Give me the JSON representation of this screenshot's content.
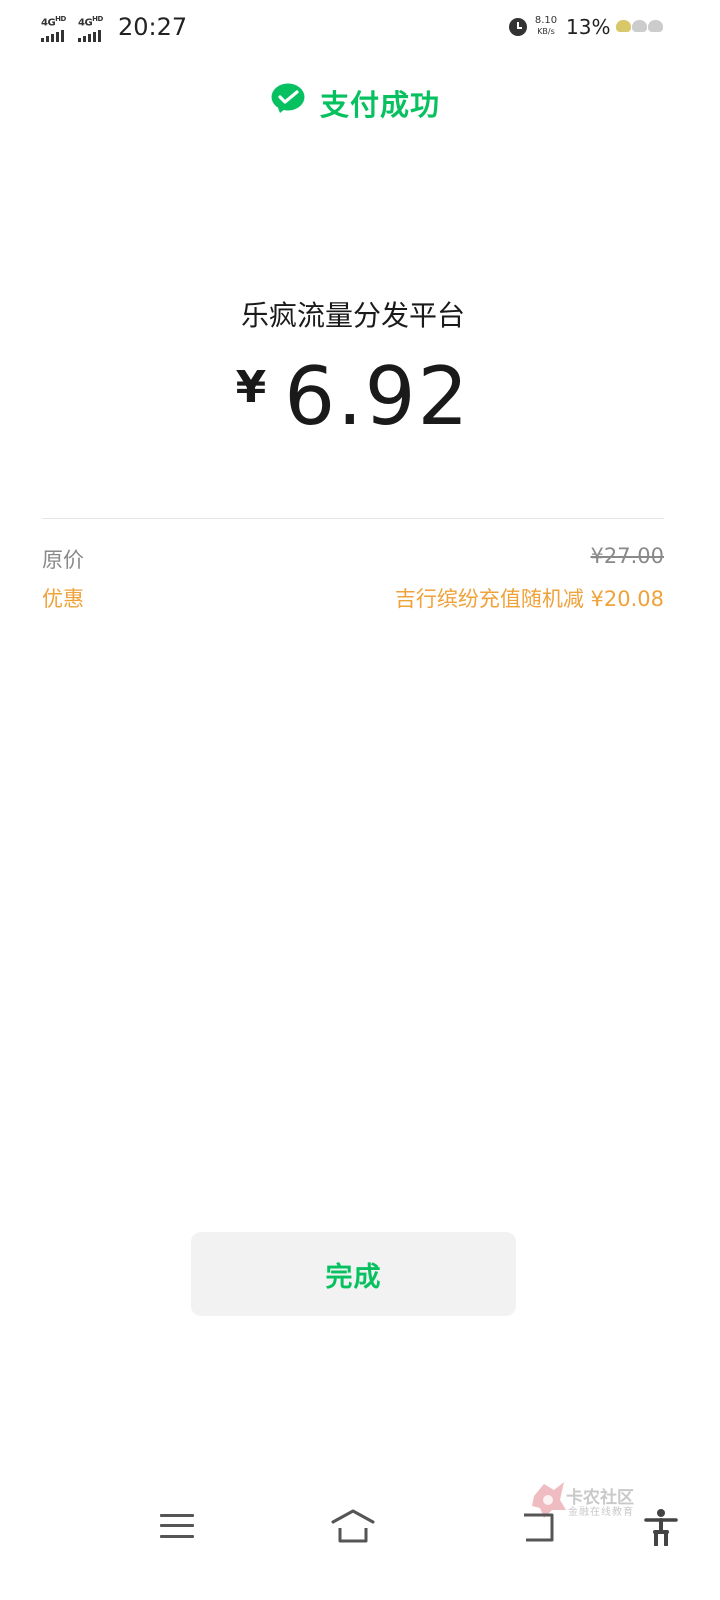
{
  "status_bar": {
    "sim1": "4G",
    "sim1_sup": "HD",
    "sim2": "4G",
    "sim2_sup": "HD",
    "time": "20:27",
    "alarm_icon": "alarm-icon",
    "net_speed_value": "8.10",
    "net_speed_unit": "KB/s",
    "battery": "13%"
  },
  "header": {
    "logo_icon": "wechat-pay-icon",
    "title": "支付成功",
    "accent_color": "#07c160"
  },
  "payment": {
    "merchant": "乐疯流量分发平台",
    "currency_symbol": "¥",
    "amount": "6.92"
  },
  "details": {
    "original_label": "原价",
    "original_value": "¥27.00",
    "discount_label": "优惠",
    "discount_value": "吉行缤纷充值随机减 ¥20.08",
    "discount_color": "#f0a23a"
  },
  "actions": {
    "done_label": "完成"
  },
  "watermark": {
    "title": "卡农社区",
    "subtitle": "金融在线教育"
  },
  "nav_bar": {
    "menu_icon": "menu-icon",
    "home_icon": "home-icon",
    "back_icon": "back-icon",
    "accessibility_icon": "accessibility-icon"
  }
}
